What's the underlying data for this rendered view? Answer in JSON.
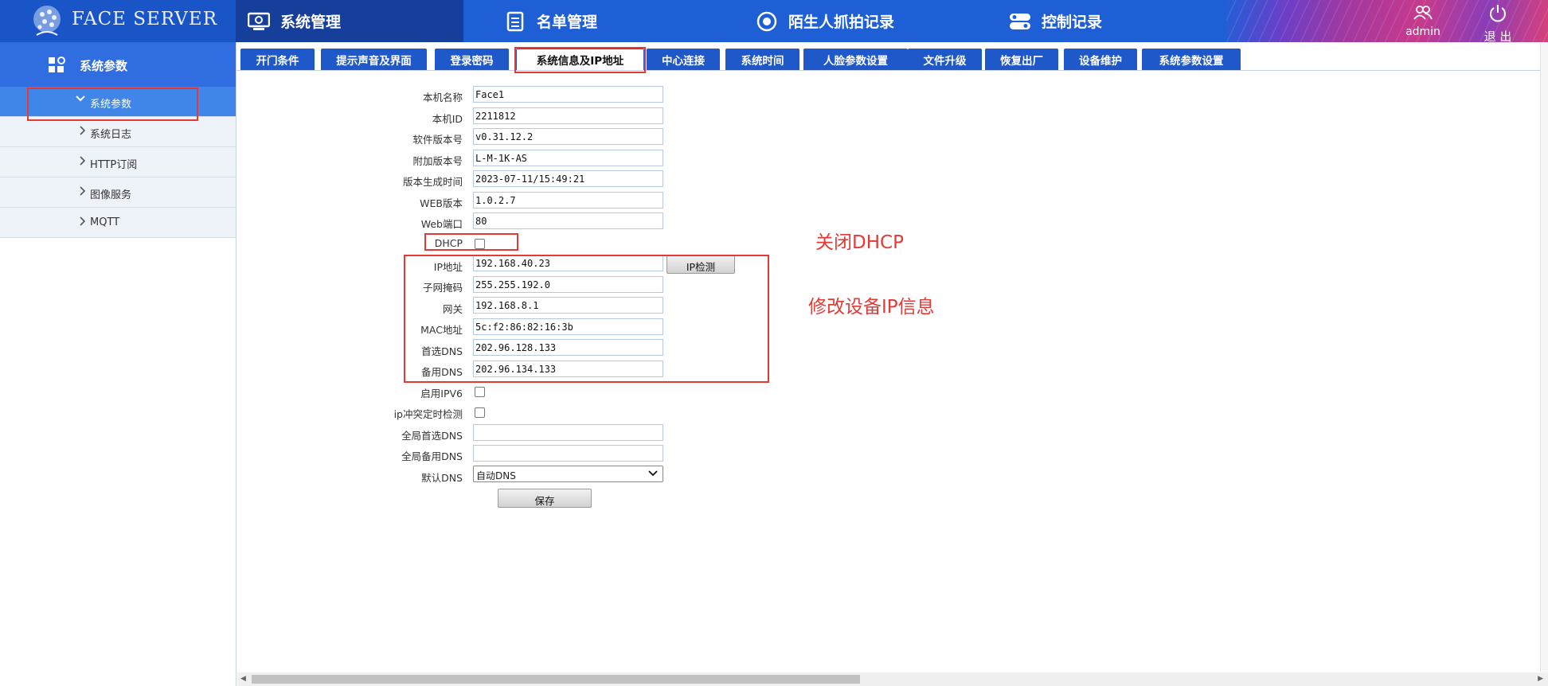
{
  "header": {
    "logo_text": "FACE SERVER",
    "nav": [
      {
        "label": "系统管理",
        "icon": "settings-monitor-icon",
        "active": true
      },
      {
        "label": "名单管理",
        "icon": "list-icon",
        "active": false
      },
      {
        "label": "陌生人抓拍记录",
        "icon": "eye-icon",
        "active": false
      },
      {
        "label": "控制记录",
        "icon": "toggle-icon",
        "active": false
      }
    ],
    "user_label": "admin",
    "logout_label": "退 出"
  },
  "sidebar": {
    "title": "系统参数",
    "items": [
      {
        "label": "系统参数",
        "active": true
      },
      {
        "label": "系统日志",
        "active": false
      },
      {
        "label": "HTTP订阅",
        "active": false
      },
      {
        "label": "图像服务",
        "active": false
      },
      {
        "label": "MQTT",
        "active": false
      }
    ]
  },
  "tabs": [
    {
      "label": "开门条件",
      "active": false
    },
    {
      "label": "提示声音及界面",
      "active": false
    },
    {
      "label": "登录密码",
      "active": false
    },
    {
      "label": "系统信息及IP地址",
      "active": true
    },
    {
      "label": "中心连接",
      "active": false
    },
    {
      "label": "系统时间",
      "active": false
    },
    {
      "label": "人脸参数设置",
      "active": false
    },
    {
      "label": "文件升级",
      "active": false
    },
    {
      "label": "恢复出厂",
      "active": false
    },
    {
      "label": "设备维护",
      "active": false
    },
    {
      "label": "系统参数设置",
      "active": false
    }
  ],
  "form": {
    "device_name": {
      "label": "本机名称",
      "value": "Face1"
    },
    "device_id": {
      "label": "本机ID",
      "value": "2211812"
    },
    "software_version": {
      "label": "软件版本号",
      "value": "v0.31.12.2"
    },
    "extra_version": {
      "label": "附加版本号",
      "value": "L-M-1K-AS"
    },
    "build_time": {
      "label": "版本生成时间",
      "value": "2023-07-11/15:49:21"
    },
    "web_version": {
      "label": "WEB版本",
      "value": "1.0.2.7"
    },
    "web_port": {
      "label": "Web端口",
      "value": "80"
    },
    "dhcp": {
      "label": "DHCP",
      "checked": false
    },
    "ip": {
      "label": "IP地址",
      "value": "192.168.40.23"
    },
    "ip_check_button": "IP检测",
    "netmask": {
      "label": "子网掩码",
      "value": "255.255.192.0"
    },
    "gateway": {
      "label": "网关",
      "value": "192.168.8.1"
    },
    "mac": {
      "label": "MAC地址",
      "value": "5c:f2:86:82:16:3b"
    },
    "primary_dns": {
      "label": "首选DNS",
      "value": "202.96.128.133"
    },
    "backup_dns": {
      "label": "备用DNS",
      "value": "202.96.134.133"
    },
    "ipv6": {
      "label": "启用IPV6",
      "checked": false
    },
    "ip_conflict": {
      "label": "ip冲突定时检测",
      "checked": false
    },
    "global_primary_dns": {
      "label": "全局首选DNS",
      "value": ""
    },
    "global_backup_dns": {
      "label": "全局备用DNS",
      "value": ""
    },
    "default_dns": {
      "label": "默认DNS",
      "value": "自动DNS"
    },
    "save_button": "保存"
  },
  "annotations": {
    "dhcp_note": "关闭DHCP",
    "ip_note": "修改设备IP信息",
    "color": "#e53935"
  },
  "colors": {
    "topbar": "#1f5fd6",
    "tab": "#1e58c9",
    "sidebar_active": "#3f86e8"
  }
}
